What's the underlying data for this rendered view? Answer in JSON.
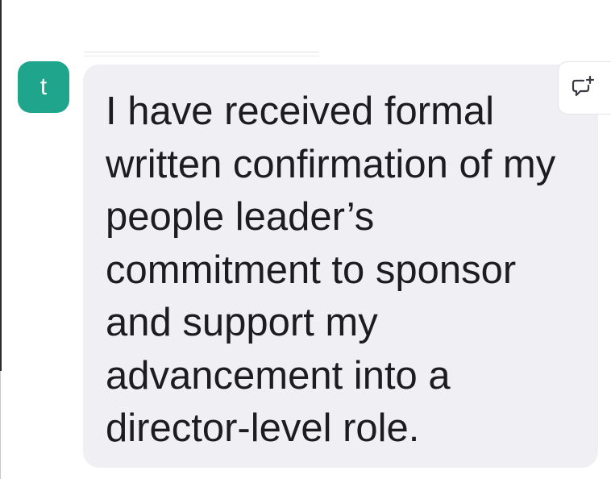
{
  "avatar": {
    "initial": "t",
    "color": "#1fa58b"
  },
  "message": {
    "text": "I have received formal written confirmation of my people leader’s commitment to sponsor and support my advancement into a director-level role."
  },
  "actions": {
    "comment_icon": "add-comment-icon"
  },
  "colors": {
    "bubble_background": "#f0eff4",
    "text": "#1c1c22",
    "avatar": "#1fa58b"
  }
}
